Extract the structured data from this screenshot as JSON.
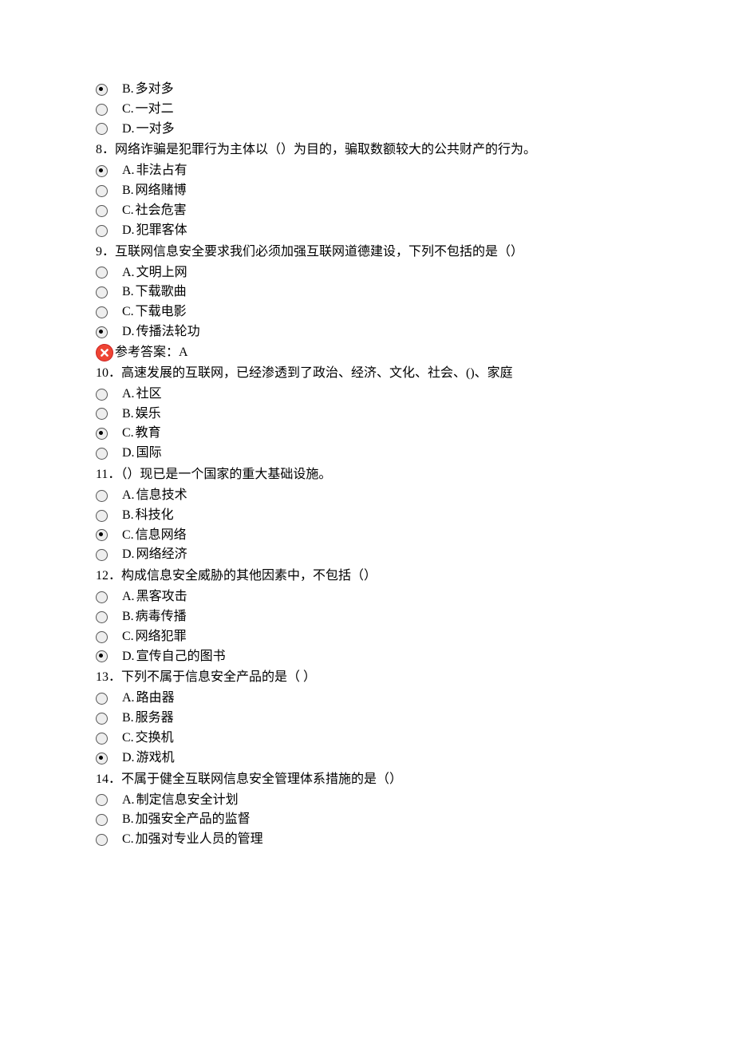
{
  "blocks": [
    {
      "type": "option",
      "selected": true,
      "label": "B.",
      "text": "多对多"
    },
    {
      "type": "option",
      "selected": false,
      "label": "C.",
      "text": "一对二"
    },
    {
      "type": "option",
      "selected": false,
      "label": "D.",
      "text": "一对多"
    },
    {
      "type": "question",
      "num": "8．",
      "text": "网络诈骗是犯罪行为主体以（）为目的，骗取数额较大的公共财产的行为。"
    },
    {
      "type": "option",
      "selected": true,
      "label": "A.",
      "text": "非法占有"
    },
    {
      "type": "option",
      "selected": false,
      "label": "B.",
      "text": "网络赌博"
    },
    {
      "type": "option",
      "selected": false,
      "label": "C.",
      "text": "社会危害"
    },
    {
      "type": "option",
      "selected": false,
      "label": "D.",
      "text": "犯罪客体"
    },
    {
      "type": "question",
      "num": "9．",
      "text": "互联网信息安全要求我们必须加强互联网道德建设，下列不包括的是（）"
    },
    {
      "type": "option",
      "selected": false,
      "label": "A.",
      "text": "文明上网"
    },
    {
      "type": "option",
      "selected": false,
      "label": "B.",
      "text": "下载歌曲"
    },
    {
      "type": "option",
      "selected": false,
      "label": "C.",
      "text": "下载电影"
    },
    {
      "type": "option",
      "selected": true,
      "label": "D.",
      "text": "传播法轮功"
    },
    {
      "type": "answer",
      "text": "参考答案：A"
    },
    {
      "type": "question",
      "num": "10．",
      "text": "高速发展的互联网，已经渗透到了政治、经济、文化、社会、()、家庭"
    },
    {
      "type": "option",
      "selected": false,
      "label": "A.",
      "text": "社区"
    },
    {
      "type": "option",
      "selected": false,
      "label": "B.",
      "text": "娱乐"
    },
    {
      "type": "option",
      "selected": true,
      "label": "C.",
      "text": "教育"
    },
    {
      "type": "option",
      "selected": false,
      "label": "D.",
      "text": "国际"
    },
    {
      "type": "question",
      "num": "11．",
      "text": "（）现已是一个国家的重大基础设施。"
    },
    {
      "type": "option",
      "selected": false,
      "label": "A.",
      "text": "信息技术"
    },
    {
      "type": "option",
      "selected": false,
      "label": "B.",
      "text": "科技化"
    },
    {
      "type": "option",
      "selected": true,
      "label": "C.",
      "text": "信息网络"
    },
    {
      "type": "option",
      "selected": false,
      "label": "D.",
      "text": "网络经济"
    },
    {
      "type": "question",
      "num": "12．",
      "text": "构成信息安全威胁的其他因素中，不包括（）"
    },
    {
      "type": "option",
      "selected": false,
      "label": "A.",
      "text": "黑客攻击"
    },
    {
      "type": "option",
      "selected": false,
      "label": "B.",
      "text": "病毒传播"
    },
    {
      "type": "option",
      "selected": false,
      "label": "C.",
      "text": "网络犯罪"
    },
    {
      "type": "option",
      "selected": true,
      "label": "D.",
      "text": "宣传自己的图书"
    },
    {
      "type": "question",
      "num": "13．",
      "text": "下列不属于信息安全产品的是（  ）"
    },
    {
      "type": "option",
      "selected": false,
      "label": "A.",
      "text": "路由器"
    },
    {
      "type": "option",
      "selected": false,
      "label": "B.",
      "text": "服务器"
    },
    {
      "type": "option",
      "selected": false,
      "label": "C.",
      "text": "交换机"
    },
    {
      "type": "option",
      "selected": true,
      "label": "D.",
      "text": "游戏机"
    },
    {
      "type": "question",
      "num": "14．",
      "text": "不属于健全互联网信息安全管理体系措施的是（）"
    },
    {
      "type": "option",
      "selected": false,
      "label": "A.",
      "text": "制定信息安全计划"
    },
    {
      "type": "option",
      "selected": false,
      "label": "B.",
      "text": "加强安全产品的监督"
    },
    {
      "type": "option",
      "selected": false,
      "label": "C.",
      "text": "加强对专业人员的管理"
    }
  ]
}
